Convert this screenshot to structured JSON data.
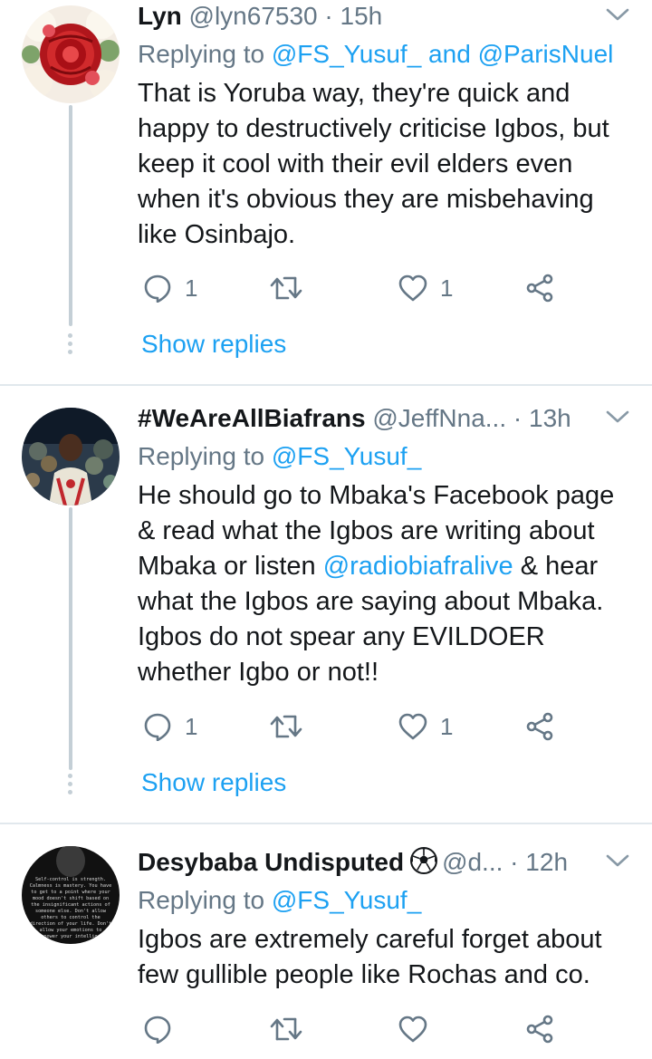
{
  "tweets": [
    {
      "name": "Lyn",
      "handle": "@lyn67530",
      "sep": " · ",
      "time": "15h",
      "replying_prefix": "Replying to ",
      "replying_to_1": "@FS_Yusuf_",
      "replying_and": " and ",
      "replying_to_2": "@ParisNuel",
      "text_lines": [
        "That is Yoruba way, they're quick and",
        "happy to destructively criticise Igbos, but",
        "keep it cool with their evil elders even",
        "when it's obvious they are misbehaving",
        "like Osinbajo."
      ],
      "reply_count": "1",
      "like_count": "1",
      "show_replies": "Show replies"
    },
    {
      "name": "#WeAreAllBiafrans",
      "handle": "@JeffNna...",
      "sep": " · ",
      "time": "13h",
      "replying_prefix": "Replying to ",
      "replying_to_1": "@FS_Yusuf_",
      "text_line_1": "He should go to Mbaka's Facebook page",
      "text_line_2": "& read what the Igbos are writing about",
      "text_line_3_pre": "Mbaka or listen ",
      "text_line_3_mention": "@radiobiafralive",
      "text_line_3_post": " & hear",
      "text_line_4": "what the Igbos are saying about Mbaka.",
      "text_line_5": "Igbos do not spear any EVILDOER",
      "text_line_6": "whether Igbo or not!!",
      "reply_count": "1",
      "like_count": "1",
      "show_replies": "Show replies"
    },
    {
      "name": "Desybaba Undisputed",
      "badge_icon": "soccer-ball-icon",
      "handle": "@d...",
      "sep": " · ",
      "time": "12h",
      "replying_prefix": "Replying to ",
      "replying_to_1": "@FS_Yusuf_",
      "text_lines": [
        "Igbos are extremely careful forget about",
        "few gullible people like Rochas and co."
      ],
      "avatar_text_lines": [
        "Self-control is strength.",
        "Calmness is mastery. You have",
        "to get to a point where your",
        "mood doesn't shift based on",
        "the insignificant actions of",
        "someone else. Don't allow",
        "others to control the",
        "direction of your life. Don't",
        "allow your emotions to",
        "overpower your intelligence"
      ]
    }
  ],
  "icons": {
    "reply": "reply-bubble-icon",
    "retweet": "retweet-icon",
    "like": "heart-icon",
    "share": "share-icon",
    "more": "chevron-down-icon"
  },
  "colors": {
    "link": "#1da1f2",
    "secondary_text": "#657786",
    "thread_line": "#c4cfd6",
    "divider": "#e1e8ed"
  }
}
